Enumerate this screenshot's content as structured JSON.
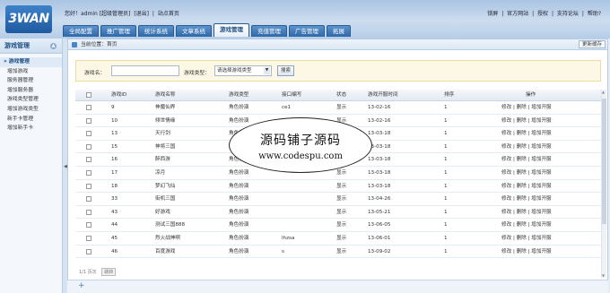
{
  "logo": {
    "text": "3WAN"
  },
  "header": {
    "welcome": "您好！admin [超级管理员]",
    "logout": "[退出]",
    "site_home": "站点首页",
    "links": [
      "锁屏",
      "官方网站",
      "授权",
      "支持论坛",
      "帮助?"
    ]
  },
  "tabs": [
    {
      "label": "全局配置",
      "active": false
    },
    {
      "label": "推广管理",
      "active": false
    },
    {
      "label": "统计系统",
      "active": false
    },
    {
      "label": "文章系统",
      "active": false
    },
    {
      "label": "游戏管理",
      "active": true
    },
    {
      "label": "充值管理",
      "active": false
    },
    {
      "label": "广告管理",
      "active": false
    },
    {
      "label": "拓展",
      "active": false
    }
  ],
  "sidebar": {
    "title": "游戏管理",
    "items": [
      {
        "label": "» 游戏管理",
        "active": true
      },
      {
        "label": "增加游戏",
        "active": false
      },
      {
        "label": "服务器管理",
        "active": false
      },
      {
        "label": "增加服务器",
        "active": false
      },
      {
        "label": "游戏类型管理",
        "active": false
      },
      {
        "label": "增加游戏类型",
        "active": false
      },
      {
        "label": "新手卡管理",
        "active": false
      },
      {
        "label": "增加新手卡",
        "active": false
      }
    ]
  },
  "breadcrumb": {
    "text": "当前位置：首页",
    "update_cache": "更新缓存"
  },
  "search": {
    "game_name_label": "游戏名：",
    "game_name_value": "",
    "type_label": "游戏类型：",
    "type_selected": "请选择游戏类型",
    "submit": "搜索"
  },
  "table": {
    "headers": [
      "游戏ID",
      "游戏名称",
      "游戏类型",
      "接口编写",
      "状态",
      "游戏开服时间",
      "排序",
      "操作"
    ],
    "actions": "修改 | 删除 | 增加开服",
    "rows": [
      {
        "id": "9",
        "name": "神魔仙界",
        "type": "角色扮演",
        "api": "ce1",
        "status": "显示",
        "date": "13-02-16",
        "sort": "1"
      },
      {
        "id": "10",
        "name": "倾世情缘",
        "type": "角色扮演",
        "api": "ce2",
        "status": "显示",
        "date": "13-02-16",
        "sort": "1"
      },
      {
        "id": "13",
        "name": "天行剑",
        "type": "角色扮演",
        "api": "",
        "status": "显示",
        "date": "13-03-18",
        "sort": "1"
      },
      {
        "id": "15",
        "name": "神将三国",
        "type": "角色扮演",
        "api": "",
        "status": "显示",
        "date": "13-03-18",
        "sort": "1"
      },
      {
        "id": "16",
        "name": "醉西游",
        "type": "角色扮演",
        "api": "",
        "status": "显示",
        "date": "13-03-18",
        "sort": "1"
      },
      {
        "id": "17",
        "name": "凉月",
        "type": "角色扮演",
        "api": "",
        "status": "显示",
        "date": "13-03-18",
        "sort": "1"
      },
      {
        "id": "18",
        "name": "梦幻飞仙",
        "type": "角色扮演",
        "api": "",
        "status": "显示",
        "date": "13-03-18",
        "sort": "1"
      },
      {
        "id": "33",
        "name": "街机三国",
        "type": "角色扮演",
        "api": "",
        "status": "显示",
        "date": "13-04-26",
        "sort": "1"
      },
      {
        "id": "43",
        "name": "好游戏",
        "type": "角色扮演",
        "api": "",
        "status": "显示",
        "date": "13-05-21",
        "sort": "1"
      },
      {
        "id": "44",
        "name": "测试三国888",
        "type": "角色扮演",
        "api": "",
        "status": "显示",
        "date": "13-06-05",
        "sort": "1"
      },
      {
        "id": "45",
        "name": "烈火战神啊",
        "type": "角色扮演",
        "api": "lhzsa",
        "status": "显示",
        "date": "13-06-01",
        "sort": "1"
      },
      {
        "id": "46",
        "name": "百度游戏",
        "type": "角色扮演",
        "api": "s",
        "status": "显示",
        "date": "13-09-02",
        "sort": "1"
      }
    ]
  },
  "pager": {
    "text": "1/1 页次",
    "btn": "跳转"
  },
  "watermark": {
    "line1": "源码铺子源码",
    "line2": "www.codespu.com"
  }
}
